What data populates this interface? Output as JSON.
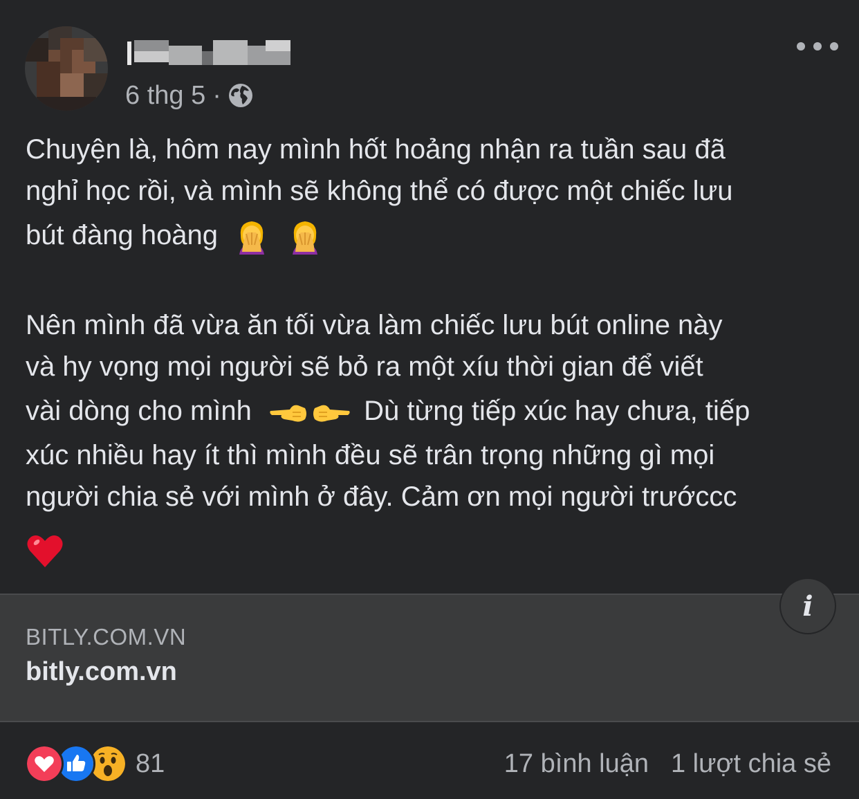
{
  "post": {
    "timestamp": "6 thg 5",
    "separator": "·",
    "privacy_icon": "globe-icon",
    "more_icon": "more-dots-icon",
    "paragraph1": [
      "Chuyện là, hôm nay mình hốt hoảng nhận ra tuần sau đã",
      "nghỉ học rồi, và mình sẽ không thể có được một chiếc lưu",
      "bút đàng hoàng"
    ],
    "paragraph2": [
      "Nên mình đã vừa ăn tối vừa làm chiếc lưu bút online này",
      "và hy vọng mọi người sẽ bỏ ra một xíu thời gian để viết",
      "vài dòng cho mình",
      "Dù từng tiếp xúc hay chưa, tiếp",
      "xúc nhiều hay ít thì mình đều sẽ trân trọng những gì mọi",
      "người chia sẻ với mình ở đây. Cảm ơn mọi người trướccc"
    ],
    "emojis": [
      "facepalm-woman-emoji",
      "pointing-fingers-emoji",
      "red-heart-emoji"
    ]
  },
  "link_preview": {
    "domain": "BITLY.COM.VN",
    "title": "bitly.com.vn",
    "info_icon": "info-icon"
  },
  "footer": {
    "reaction_icons": [
      "love-reaction-icon",
      "like-reaction-icon",
      "wow-reaction-icon"
    ],
    "reaction_count": "81",
    "comments": "17 bình luận",
    "shares": "1 lượt chia sẻ"
  },
  "colors": {
    "background": "#242527",
    "card": "#3a3b3c",
    "text": "#e4e6eb",
    "secondary_text": "#b0b3b8",
    "like_blue": "#1877f2",
    "love_red": "#f33e58",
    "wow_yellow": "#f7b125"
  }
}
